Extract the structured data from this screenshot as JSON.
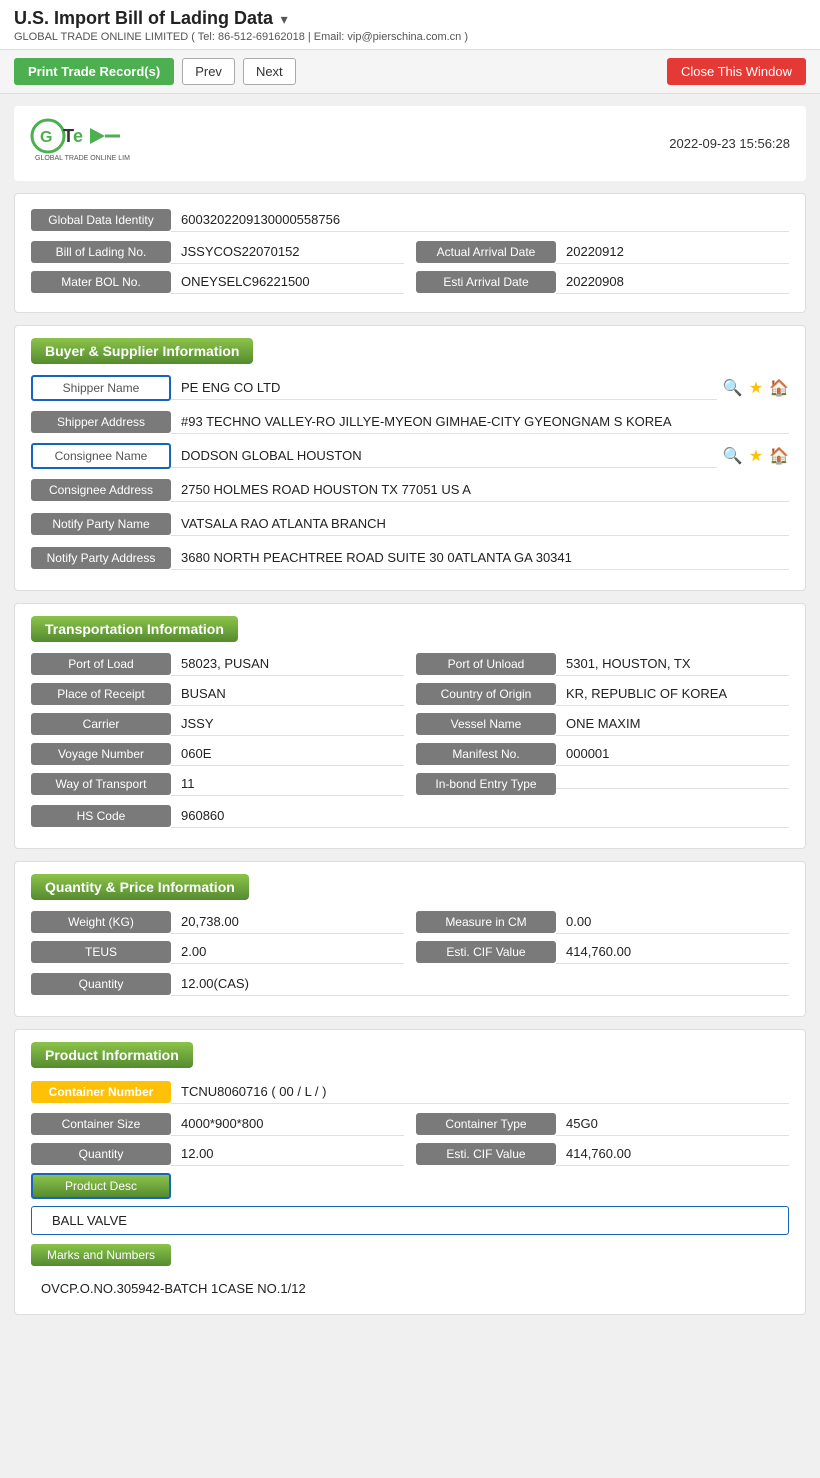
{
  "page": {
    "title": "U.S. Import Bill of Lading Data",
    "title_arrow": "▾",
    "subtitle": "GLOBAL TRADE ONLINE LIMITED ( Tel: 86-512-69162018 | Email: vip@pierschina.com.cn )",
    "datetime": "2022-09-23 15:56:28"
  },
  "toolbar": {
    "print_label": "Print Trade Record(s)",
    "prev_label": "Prev",
    "next_label": "Next",
    "close_label": "Close This Window"
  },
  "identity": {
    "global_data_label": "Global Data Identity",
    "global_data_value": "6003202209130000558756",
    "bol_label": "Bill of Lading No.",
    "bol_value": "JSSYCOS22070152",
    "actual_arrival_label": "Actual Arrival Date",
    "actual_arrival_value": "20220912",
    "master_bol_label": "Mater BOL No.",
    "master_bol_value": "ONEYSELC96221500",
    "esti_arrival_label": "Esti Arrival Date",
    "esti_arrival_value": "20220908"
  },
  "buyer_supplier": {
    "section_label": "Buyer & Supplier Information",
    "shipper_name_label": "Shipper Name",
    "shipper_name_value": "PE ENG CO LTD",
    "shipper_address_label": "Shipper Address",
    "shipper_address_value": "#93 TECHNO VALLEY-RO JILLYE-MYEON GIMHAE-CITY GYEONGNAM S KOREA",
    "consignee_name_label": "Consignee Name",
    "consignee_name_value": "DODSON GLOBAL HOUSTON",
    "consignee_address_label": "Consignee Address",
    "consignee_address_value": "2750 HOLMES ROAD HOUSTON TX 77051 US A",
    "notify_party_name_label": "Notify Party Name",
    "notify_party_name_value": "VATSALA RAO ATLANTA BRANCH",
    "notify_party_address_label": "Notify Party Address",
    "notify_party_address_value": "3680 NORTH PEACHTREE ROAD SUITE 30 0ATLANTA GA 30341"
  },
  "transportation": {
    "section_label": "Transportation Information",
    "port_of_load_label": "Port of Load",
    "port_of_load_value": "58023, PUSAN",
    "port_of_unload_label": "Port of Unload",
    "port_of_unload_value": "5301, HOUSTON, TX",
    "place_of_receipt_label": "Place of Receipt",
    "place_of_receipt_value": "BUSAN",
    "country_of_origin_label": "Country of Origin",
    "country_of_origin_value": "KR, REPUBLIC OF KOREA",
    "carrier_label": "Carrier",
    "carrier_value": "JSSY",
    "vessel_name_label": "Vessel Name",
    "vessel_name_value": "ONE MAXIM",
    "voyage_number_label": "Voyage Number",
    "voyage_number_value": "060E",
    "manifest_no_label": "Manifest No.",
    "manifest_no_value": "000001",
    "way_of_transport_label": "Way of Transport",
    "way_of_transport_value": "11",
    "in_bond_entry_label": "In-bond Entry Type",
    "in_bond_entry_value": "",
    "hs_code_label": "HS Code",
    "hs_code_value": "960860"
  },
  "quantity_price": {
    "section_label": "Quantity & Price Information",
    "weight_label": "Weight (KG)",
    "weight_value": "20,738.00",
    "measure_label": "Measure in CM",
    "measure_value": "0.00",
    "teus_label": "TEUS",
    "teus_value": "2.00",
    "esti_cif_label": "Esti. CIF Value",
    "esti_cif_value": "414,760.00",
    "quantity_label": "Quantity",
    "quantity_value": "12.00(CAS)"
  },
  "product": {
    "section_label": "Product Information",
    "container_number_label": "Container Number",
    "container_number_value": "TCNU8060716 ( 00 / L / )",
    "container_size_label": "Container Size",
    "container_size_value": "4000*900*800",
    "container_type_label": "Container Type",
    "container_type_value": "45G0",
    "quantity_label": "Quantity",
    "quantity_value": "12.00",
    "esti_cif_label": "Esti. CIF Value",
    "esti_cif_value": "414,760.00",
    "product_desc_label": "Product Desc",
    "product_desc_value": "BALL VALVE",
    "marks_label": "Marks and Numbers",
    "marks_value": "OVCP.O.NO.305942-BATCH 1CASE NO.1/12"
  }
}
